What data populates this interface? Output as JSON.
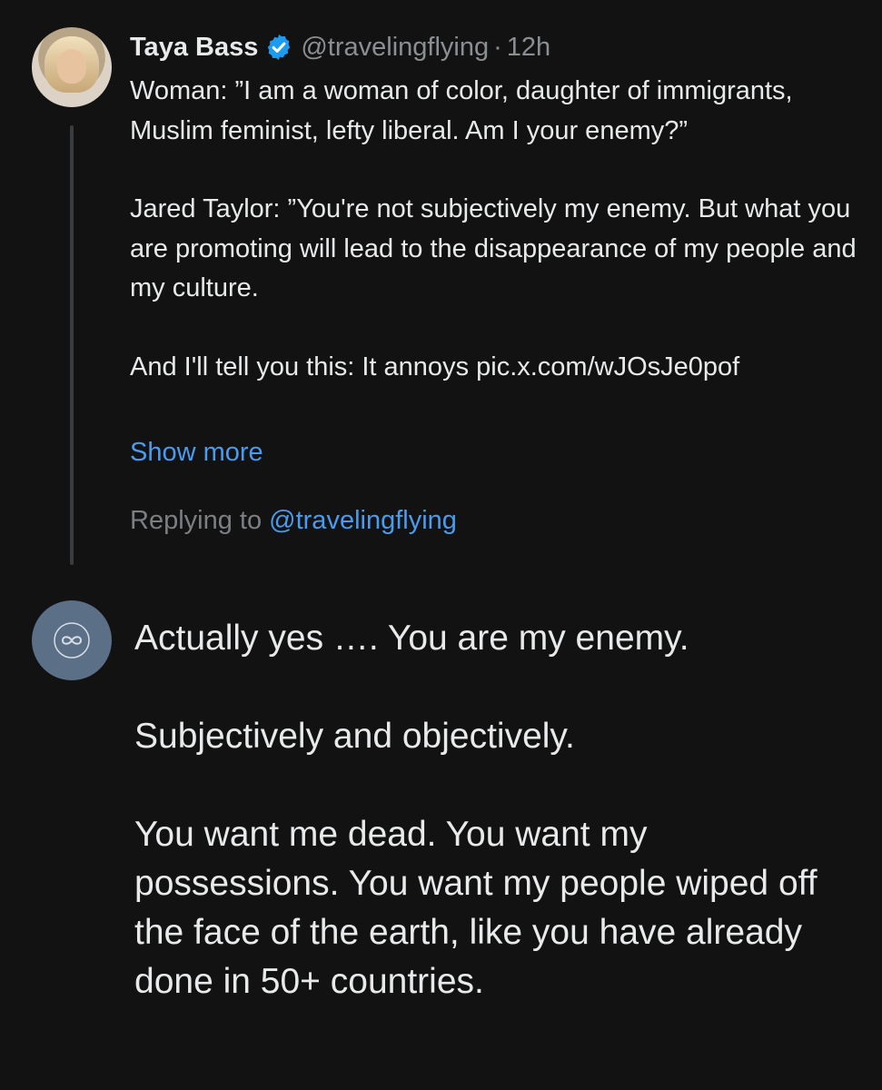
{
  "tweet": {
    "author_name": "Taya Bass",
    "handle": "@travelingflying",
    "separator": "·",
    "time": "12h",
    "paragraphs": [
      "Woman: ”I am a woman of color, daughter of immigrants, Muslim feminist, lefty liberal.  Am I your enemy?”",
      "Jared Taylor: ”You're not subjectively my enemy. But what you are promoting will lead to the disappearance of my people and my culture.",
      "And I'll tell you this: It annoys pic.x.com/wJOsJe0pof"
    ],
    "show_more": "Show more",
    "replying_prefix": "Replying to",
    "replying_mention": "@travelingflying"
  },
  "reply": {
    "avatar_icon": "infinity-icon",
    "paragraphs": [
      "Actually yes …. You are my enemy.",
      "Subjectively and objectively.",
      "You want me dead. You want my possessions. You want my people wiped off the face of the earth, like you have already done in 50+ countries."
    ]
  },
  "colors": {
    "background": "#121212",
    "text": "#e7e9ea",
    "secondary_text": "#8b8f93",
    "link": "#4a9bef",
    "verified_badge": "#1d9bf0",
    "reply_avatar": "#5b6f87"
  }
}
